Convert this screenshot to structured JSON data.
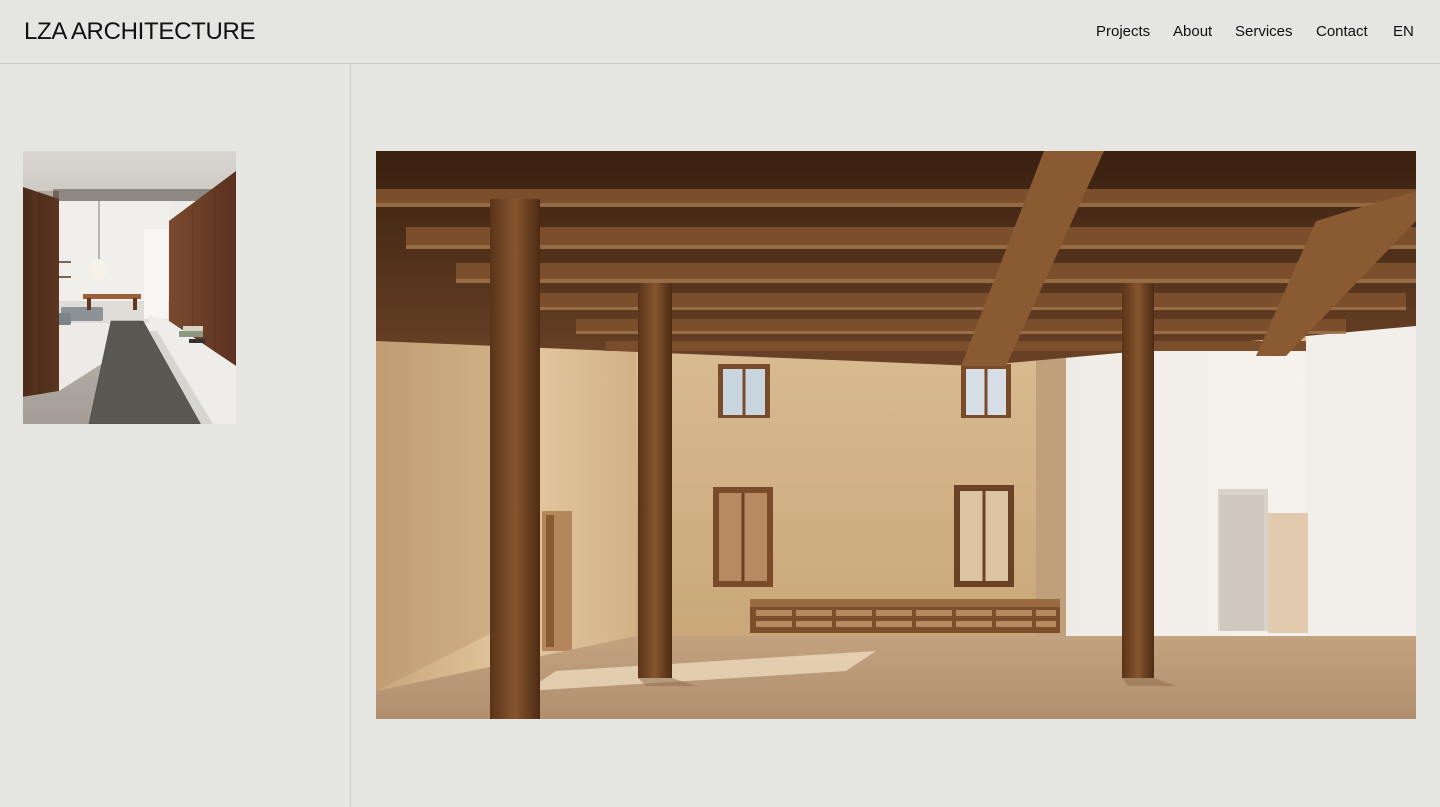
{
  "header": {
    "logo": "LZA ARCHITECTURE",
    "nav": [
      {
        "label": "Projects"
      },
      {
        "label": "About"
      },
      {
        "label": "Services"
      },
      {
        "label": "Contact"
      },
      {
        "label": "EN"
      }
    ]
  },
  "gallery": {
    "thumbnail": {
      "subject": "interior-corridor-photo"
    },
    "hero": {
      "subject": "timber-barn-interior-photo"
    }
  },
  "colors": {
    "background": "#e5e6e1",
    "divider": "#c9cac5",
    "text": "#111111"
  }
}
